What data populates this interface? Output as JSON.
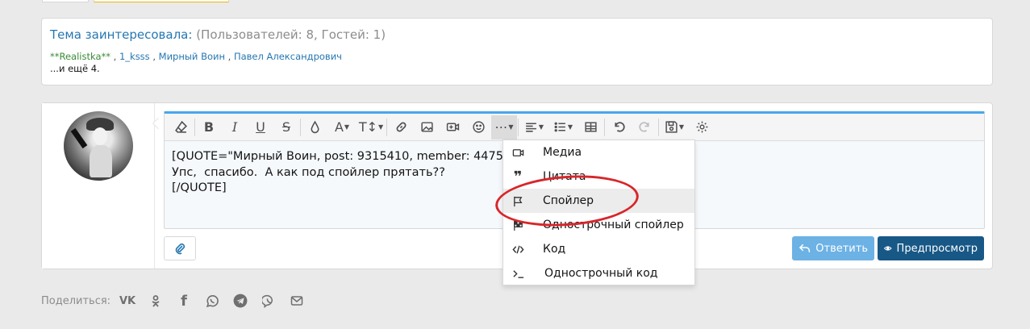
{
  "viewers": {
    "title_link": "Тема заинтересовала:",
    "count": "(Пользователей: 8, Гостей: 1)",
    "users": [
      "**Realistka**",
      "1_ksss",
      "Мирный Воин",
      "Павел Александрович"
    ],
    "separator": " , ",
    "more": "...и ещё 4."
  },
  "editor": {
    "lines": [
      "[QUOTE=\"Мирный Воин, post: 9315410, member: 44753\"]",
      "Упс,  спасибо.  А как под спойлер прятать??",
      "[/QUOTE]"
    ],
    "toolbar_icons": [
      "eraser-icon",
      "bold-icon",
      "italic-icon",
      "underline-icon",
      "strike-icon",
      "color-icon",
      "font-size-icon",
      "text-height-icon",
      "link-icon",
      "image-icon",
      "video-icon",
      "smilie-icon",
      "more-icon",
      "align-icon",
      "list-icon",
      "table-icon",
      "undo-icon",
      "redo-icon",
      "drafts-icon",
      "settings-icon"
    ]
  },
  "dropdown": {
    "items": [
      {
        "label": "Медиа",
        "icon": "video-camera-icon"
      },
      {
        "label": "Цитата",
        "icon": "quote-icon"
      },
      {
        "label": "Спойлер",
        "icon": "flag-icon"
      },
      {
        "label": "Однострочный спойлер",
        "icon": "checkered-flag-icon"
      },
      {
        "label": "Код",
        "icon": "code-icon"
      },
      {
        "label": "Однострочный код",
        "icon": "terminal-icon"
      }
    ]
  },
  "buttons": {
    "reply": "Ответить",
    "preview": "Предпросмотр"
  },
  "share": {
    "label": "Поделиться:",
    "networks": [
      "vk-icon",
      "odnoklassniki-icon",
      "facebook-icon",
      "whatsapp-icon",
      "telegram-icon",
      "viber-icon",
      "email-icon"
    ]
  },
  "colors": {
    "link": "#2577b1",
    "accent": "#47a7eb",
    "reply_button": "#6cb2e4",
    "preview_button": "#185886",
    "annotation_ring": "#d8262a"
  }
}
